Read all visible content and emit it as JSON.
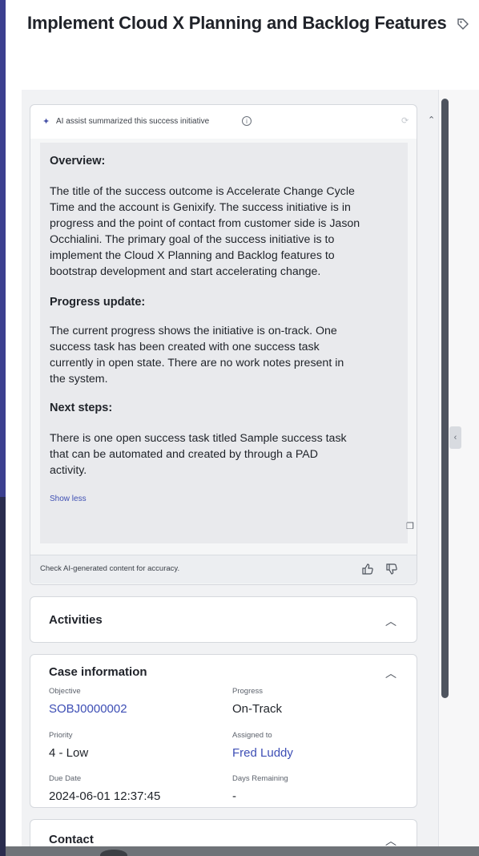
{
  "header": {
    "title": "Implement Cloud X Planning and Backlog Features",
    "tag_icon": "tag-icon"
  },
  "ai_summary": {
    "header_label": "AI assist summarized this success initiative",
    "sections": {
      "overview_heading": "Overview:",
      "overview_lines": [
        "The title of the success outcome is Accelerate Change Cycle",
        "Time and the account is Genixify. The success initiative is in",
        "progress and the point of contact from customer side is Jason",
        "Occhialini. The primary goal of the success initiative is to",
        "implement the Cloud X Planning and Backlog features to",
        "bootstrap development and start accelerating change."
      ],
      "progress_heading": "Progress update:",
      "progress_lines": [
        "The current progress shows the initiative is on-track. One",
        "success task has been created with one success task",
        "currently in open state. There are no work notes present in",
        "the system."
      ],
      "next_heading": "Next steps:",
      "next_lines": [
        "There is one open success task titled Sample success task",
        "that can be automated and created by through a PAD",
        "activity."
      ]
    },
    "show_less": "Show less",
    "footer_note": "Check AI-generated content for accuracy."
  },
  "activities": {
    "title": "Activities"
  },
  "case_information": {
    "title": "Case information",
    "objective_label": "Objective",
    "objective_value": "SOBJ0000002",
    "progress_label": "Progress",
    "progress_value": "On-Track",
    "priority_label": "Priority",
    "priority_value": "4 - Low",
    "assigned_label": "Assigned to",
    "assigned_value": "Fred Luddy",
    "due_label": "Due Date",
    "due_value": "2024-06-01 12:37:45",
    "days_label": "Days Remaining",
    "days_value": "-"
  },
  "contact": {
    "title": "Contact"
  },
  "colors": {
    "accent": "#3d4eb5",
    "rail": "#3b3f8f",
    "panel_bg": "#f1f2f4"
  }
}
